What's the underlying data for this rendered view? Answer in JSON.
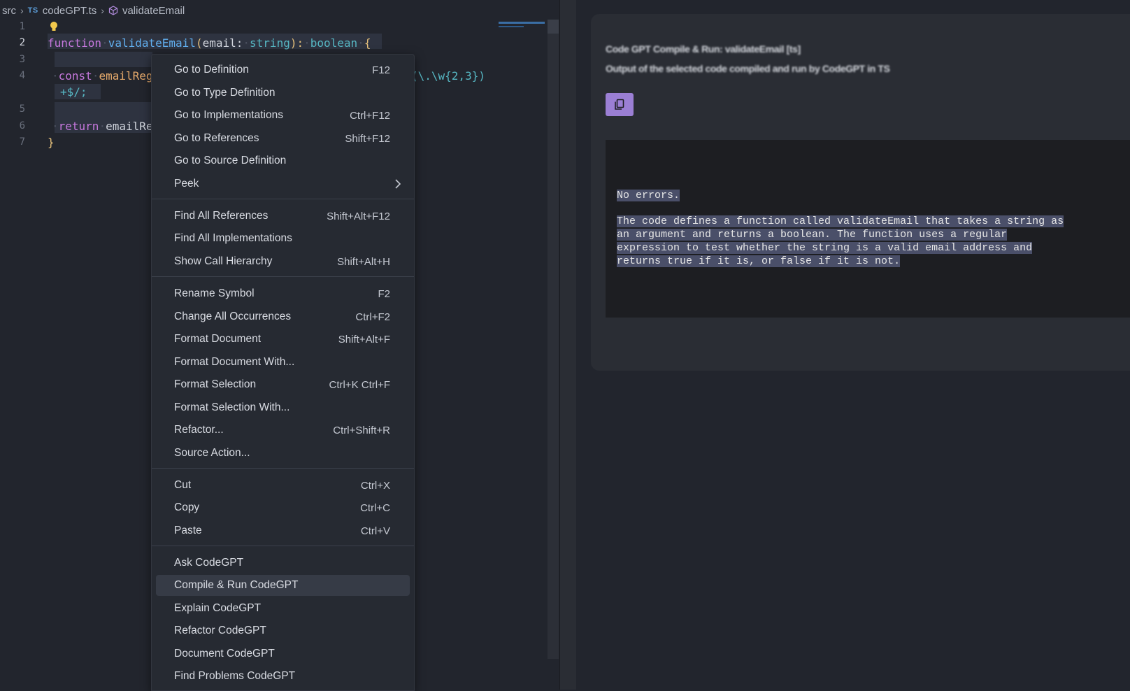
{
  "breadcrumb": {
    "folder": "src",
    "lang_badge": "TS",
    "file": "codeGPT.ts",
    "symbol": "validateEmail"
  },
  "editor": {
    "line_numbers": [
      "1",
      "2",
      "3",
      "4",
      "5",
      "6",
      "7"
    ],
    "active_line": "2",
    "code": {
      "l2_kw": "function",
      "l2_fn": "validateEmail",
      "l2_open": "(",
      "l2_param": "email",
      "l2_colon": ":",
      "l2_type": "string",
      "l2_close": "):",
      "l2_ret": "boolean",
      "l2_brace": "{",
      "l4_kw": "const",
      "l4_var": "emailReg",
      "l4_tail": "(\\.\\w{2,3})",
      "l4b": "+$/;",
      "l6_kw": "return",
      "l6_var": "emailRe",
      "l7": "}"
    }
  },
  "context_menu": {
    "items": [
      {
        "label": "Go to Definition",
        "key": "F12"
      },
      {
        "label": "Go to Type Definition",
        "key": ""
      },
      {
        "label": "Go to Implementations",
        "key": "Ctrl+F12"
      },
      {
        "label": "Go to References",
        "key": "Shift+F12"
      },
      {
        "label": "Go to Source Definition",
        "key": ""
      },
      {
        "label": "Peek",
        "key": ""
      },
      {
        "label": "Find All References",
        "key": "Shift+Alt+F12"
      },
      {
        "label": "Find All Implementations",
        "key": ""
      },
      {
        "label": "Show Call Hierarchy",
        "key": "Shift+Alt+H"
      },
      {
        "label": "Rename Symbol",
        "key": "F2"
      },
      {
        "label": "Change All Occurrences",
        "key": "Ctrl+F2"
      },
      {
        "label": "Format Document",
        "key": "Shift+Alt+F"
      },
      {
        "label": "Format Document With...",
        "key": ""
      },
      {
        "label": "Format Selection",
        "key": "Ctrl+K Ctrl+F"
      },
      {
        "label": "Format Selection With...",
        "key": ""
      },
      {
        "label": "Refactor...",
        "key": "Ctrl+Shift+R"
      },
      {
        "label": "Source Action...",
        "key": ""
      },
      {
        "label": "Cut",
        "key": "Ctrl+X"
      },
      {
        "label": "Copy",
        "key": "Ctrl+C"
      },
      {
        "label": "Paste",
        "key": "Ctrl+V"
      },
      {
        "label": "Ask CodeGPT",
        "key": ""
      },
      {
        "label": "Compile & Run CodeGPT",
        "key": ""
      },
      {
        "label": "Explain CodeGPT",
        "key": ""
      },
      {
        "label": "Refactor CodeGPT",
        "key": ""
      },
      {
        "label": "Document CodeGPT",
        "key": ""
      },
      {
        "label": "Find Problems CodeGPT",
        "key": ""
      }
    ],
    "highlighted": "Compile & Run CodeGPT"
  },
  "panel": {
    "header_line1": "Code GPT Compile & Run: validateEmail [ts]",
    "header_line2": "Output of the selected code compiled and run by CodeGPT in TS",
    "copy_icon": "copy-icon",
    "output": [
      "No errors.",
      "",
      "The code defines a function called validateEmail that takes a string as",
      "an argument and returns a boolean. The function uses a regular",
      "expression to test whether the string is a valid email address and",
      "returns true if it is, or false if it is not."
    ]
  },
  "colors": {
    "accent": "#9b7fd4",
    "editor_bg": "#22252d",
    "menu_bg": "#262a32",
    "selection": "#4a4f69"
  }
}
